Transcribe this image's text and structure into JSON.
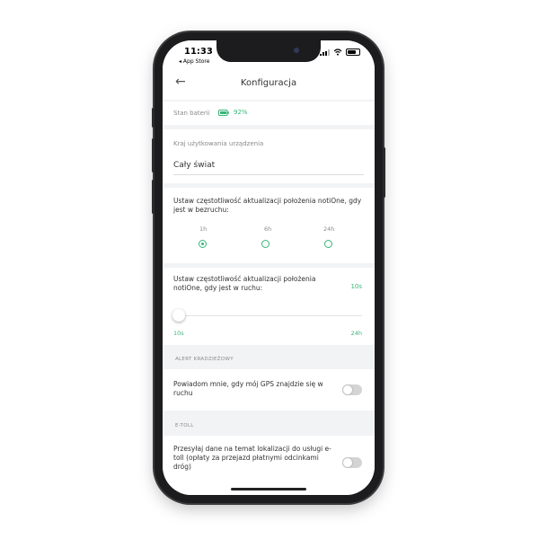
{
  "status_bar": {
    "time": "11:33",
    "back_app": "◂ App Store"
  },
  "header": {
    "title": "Konfiguracja"
  },
  "battery": {
    "label": "Stan baterii",
    "value": "92%"
  },
  "usage_country": {
    "label": "Kraj użytkowania urządzenia",
    "value": "Cały świat"
  },
  "rest_frequency": {
    "label": "Ustaw częstotliwość aktualizacji położenia notiOne, gdy jest w bezruchu:",
    "options": [
      {
        "label": "1h",
        "selected": true
      },
      {
        "label": "6h",
        "selected": false
      },
      {
        "label": "24h",
        "selected": false
      }
    ]
  },
  "motion_frequency": {
    "label": "Ustaw częstotliwość aktualizacji położenia notiOne, gdy jest w ruchu:",
    "current": "10s",
    "min_label": "10s",
    "max_label": "24h",
    "slider_fraction": 0
  },
  "theft_alert": {
    "section_label": "ALERT KRADZIEŻOWY",
    "toggle_label": "Powiadom mnie, gdy mój GPS znajdzie się w ruchu",
    "enabled": false
  },
  "etoll": {
    "section_label": "E-TOLL",
    "toggle_label": "Przesyłaj dane na temat lokalizacji do usługi e-toll (opłaty za przejazd płatnymi odcinkami dróg)",
    "enabled": false
  },
  "colors": {
    "accent": "#39b57a",
    "background": "#f2f3f5",
    "card": "#ffffff"
  }
}
